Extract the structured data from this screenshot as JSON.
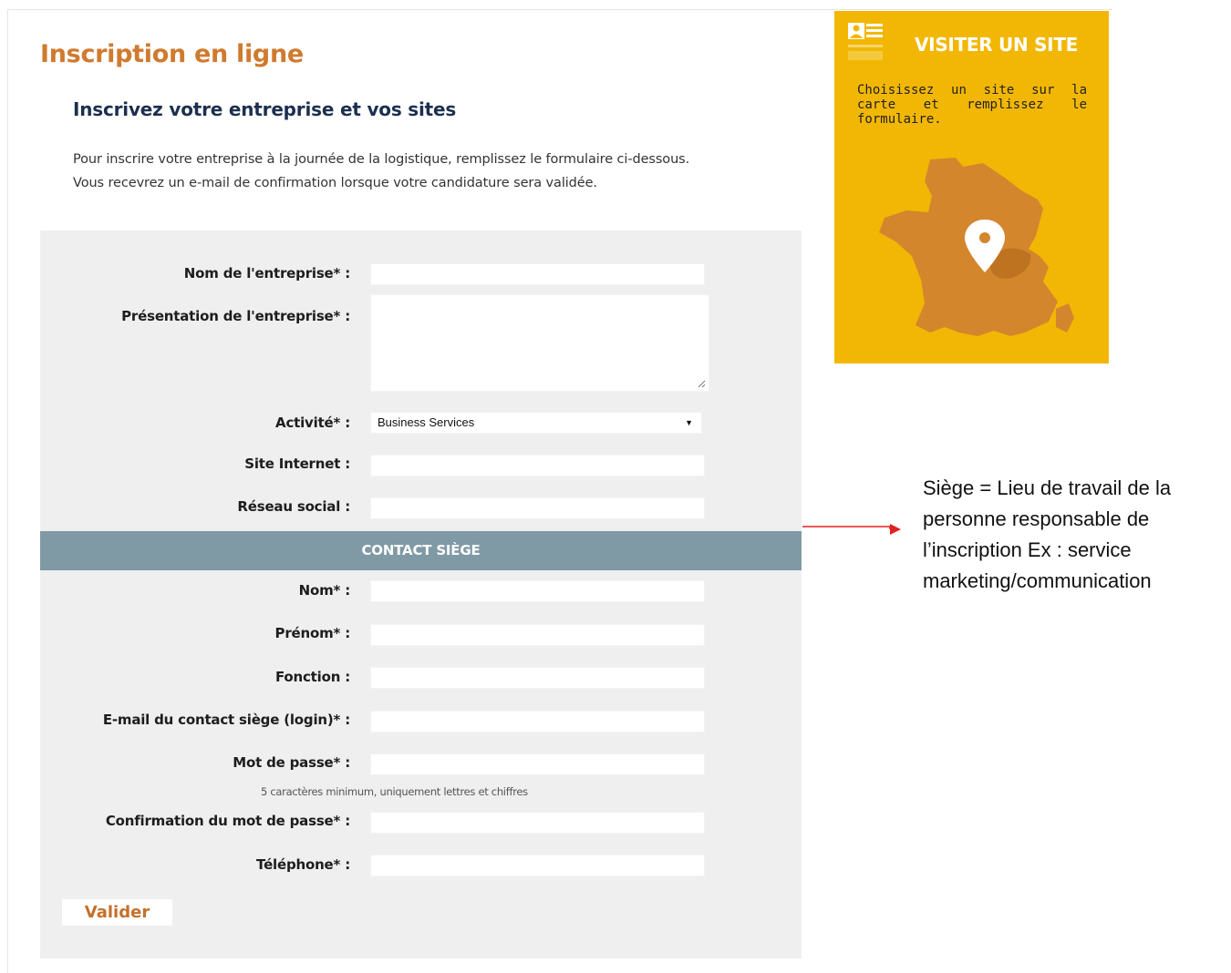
{
  "page": {
    "title": "Inscription en ligne",
    "subtitle": "Inscrivez votre entreprise et vos sites",
    "intro_line1": "Pour inscrire votre entreprise à la journée de la logistique, remplissez le formulaire ci-dessous.",
    "intro_line2": "Vous recevrez un e-mail de confirmation lorsque votre candidature sera validée."
  },
  "form": {
    "company_name_label": "Nom de l'entreprise* :",
    "company_name_value": "",
    "presentation_label": "Présentation de l'entreprise* :",
    "presentation_value": "",
    "activity_label": "Activité* :",
    "activity_selected": "Business Services",
    "website_label": "Site Internet :",
    "website_value": "",
    "social_label": "Réseau social :",
    "social_value": "",
    "contact_section_title": "CONTACT SIÈGE",
    "last_name_label": "Nom* :",
    "last_name_value": "",
    "first_name_label": "Prénom* :",
    "first_name_value": "",
    "function_label": "Fonction :",
    "function_value": "",
    "email_label": "E-mail du contact siège (login)* :",
    "email_value": "",
    "password_label": "Mot de passe* :",
    "password_value": "",
    "password_hint": "5 caractères minimum, uniquement lettres et chiffres",
    "password_confirm_label": "Confirmation du mot de passe* :",
    "password_confirm_value": "",
    "phone_label": "Téléphone* :",
    "phone_value": "",
    "submit_label": "Valider"
  },
  "promo": {
    "title": "VISITER UN SITE",
    "text": "Choisissez un site sur la carte et remplissez le formulaire.",
    "icon": "id-card-icon",
    "map": "france-map-pin"
  },
  "annotation": {
    "text": "Siège = Lieu de travail de la personne responsable de l’inscription Ex : service marketing/communication"
  },
  "colors": {
    "title_orange": "#d07a2e",
    "subtitle_navy": "#1c2f4f",
    "panel_grey": "#efefef",
    "section_bar": "#7f99a5",
    "promo_yellow": "#f2b705",
    "map_orange": "#d4862d",
    "annotation_arrow": "#e02020"
  }
}
